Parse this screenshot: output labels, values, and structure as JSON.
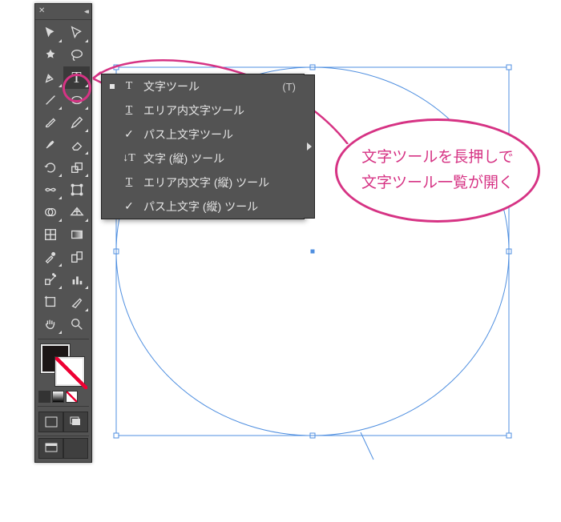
{
  "flyout": {
    "items": [
      {
        "label": "文字ツール",
        "shortcut": "(T)",
        "icon": "T",
        "active": true
      },
      {
        "label": "エリア内文字ツール",
        "shortcut": "",
        "icon": "T̲",
        "active": false
      },
      {
        "label": "パス上文字ツール",
        "shortcut": "",
        "icon": "~",
        "active": false
      },
      {
        "label": "文字 (縦) ツール",
        "shortcut": "",
        "icon": "↓T",
        "active": false
      },
      {
        "label": "エリア内文字 (縦) ツール",
        "shortcut": "",
        "icon": "T̲",
        "active": false
      },
      {
        "label": "パス上文字 (縦) ツール",
        "shortcut": "",
        "icon": "~",
        "active": false
      }
    ]
  },
  "callout": {
    "line1": "文字ツールを長押しで",
    "line2": "文字ツール一覧が開く"
  },
  "colors": {
    "accent": "#d63384",
    "panel": "#535353"
  }
}
